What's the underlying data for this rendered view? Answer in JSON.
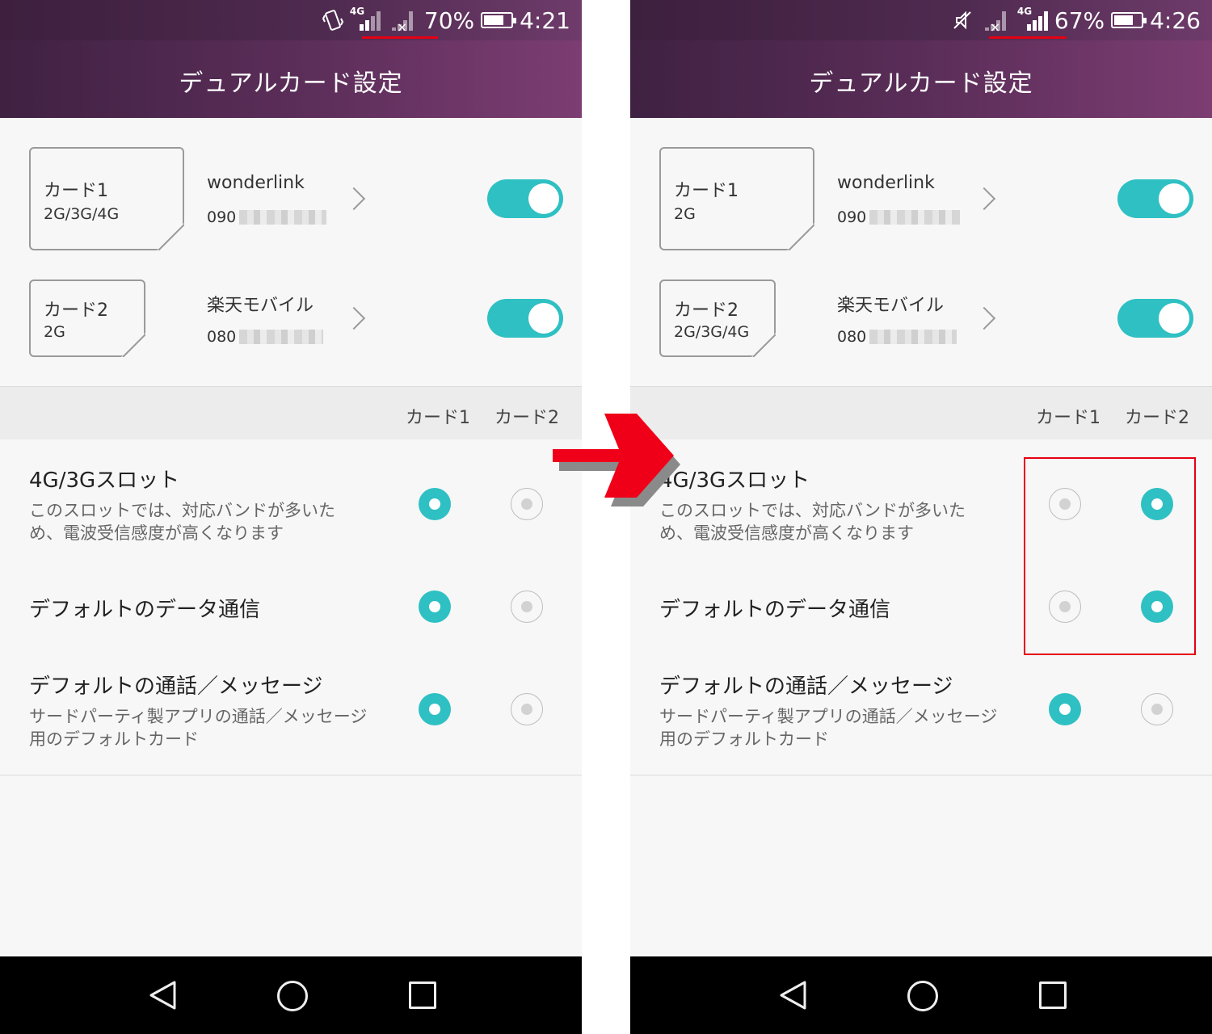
{
  "left": {
    "status": {
      "battery_pct": "70%",
      "time": "4:21",
      "battery_level": 0.7
    },
    "title": "デュアルカード設定",
    "card1": {
      "name": "カード1",
      "network": "2G/3G/4G",
      "carrier": "wonderlink",
      "number": "090",
      "enabled": true
    },
    "card2": {
      "name": "カード2",
      "network": "2G",
      "carrier": "楽天モバイル",
      "number": "080",
      "enabled": true
    },
    "columns": [
      "カード1",
      "カード2"
    ],
    "rows": [
      {
        "title": "4G/3Gスロット",
        "desc": "このスロットでは、対応バンドが多いため、電波受信感度が高くなります",
        "selected": "カード1"
      },
      {
        "title": "デフォルトのデータ通信",
        "desc": "",
        "selected": "カード1"
      },
      {
        "title": "デフォルトの通話／メッセージ",
        "desc": "サードパーティ製アプリの通話／メッセージ用のデフォルトカード",
        "selected": "カード1"
      }
    ]
  },
  "right": {
    "status": {
      "battery_pct": "67%",
      "time": "4:26",
      "battery_level": 0.67
    },
    "title": "デュアルカード設定",
    "card1": {
      "name": "カード1",
      "network": "2G",
      "carrier": "wonderlink",
      "number": "090",
      "enabled": true
    },
    "card2": {
      "name": "カード2",
      "network": "2G/3G/4G",
      "carrier": "楽天モバイル",
      "number": "080",
      "enabled": true
    },
    "columns": [
      "カード1",
      "カード2"
    ],
    "rows": [
      {
        "title": "4G/3Gスロット",
        "desc": "このスロットでは、対応バンドが多いため、電波受信感度が高くなります",
        "selected": "カード2"
      },
      {
        "title": "デフォルトのデータ通信",
        "desc": "",
        "selected": "カード2"
      },
      {
        "title": "デフォルトの通話／メッセージ",
        "desc": "サードパーティ製アプリの通話／メッセージ用のデフォルトカード",
        "selected": "カード1"
      }
    ]
  },
  "icons": {
    "vibrate": "vibrate-icon",
    "mute": "mute-icon",
    "signal_4g": "signal-4g-icon",
    "signal_nosim": "signal-x-icon",
    "battery": "battery-icon",
    "chevron": "chevron-right-icon",
    "nav_back": "back-icon",
    "nav_home": "home-icon",
    "nav_recent": "recent-apps-icon",
    "transition_arrow": "red-arrow-icon"
  },
  "colors": {
    "accent": "#2fc0c3",
    "header": "#5a2d58",
    "annotation": "#e60012"
  }
}
